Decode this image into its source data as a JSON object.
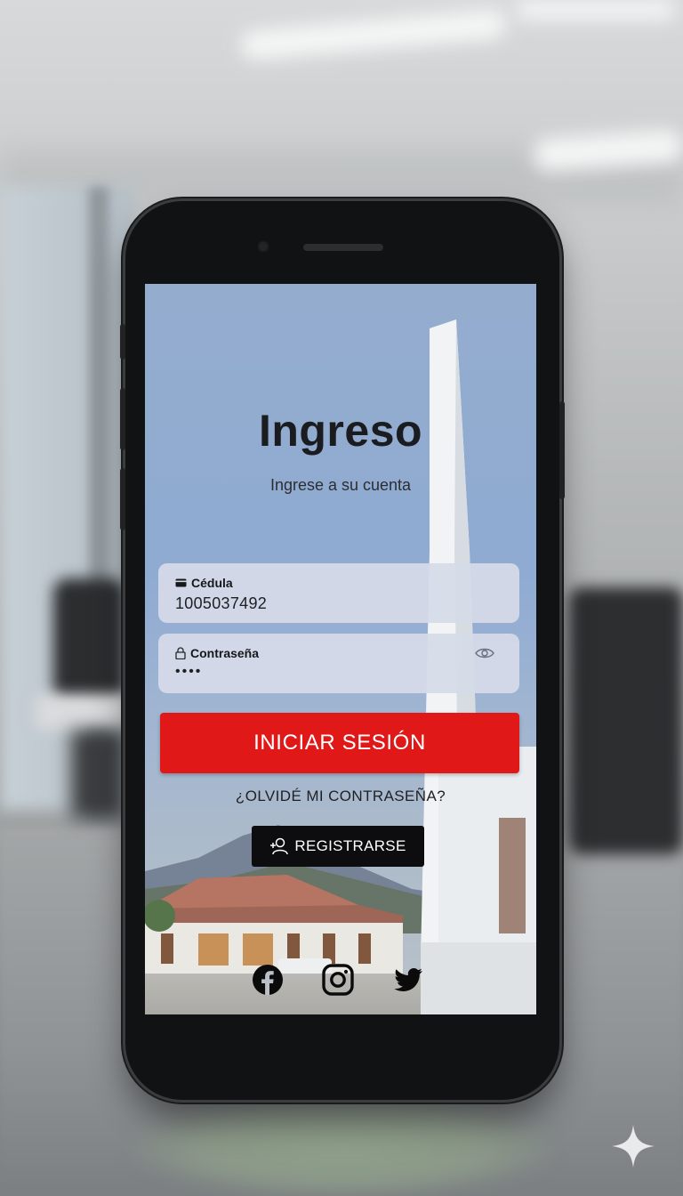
{
  "login": {
    "title": "Ingreso",
    "subtitle": "Ingrese a su cuenta",
    "id_field": {
      "label": "Cédula",
      "value": "1005037492",
      "icon": "id-card-icon"
    },
    "password_field": {
      "label": "Contraseña",
      "value": "••••",
      "icon": "lock-icon",
      "toggle_icon": "eye-icon"
    },
    "submit_label": "INICIAR SESIÓN",
    "forgot_label": "¿OLVIDÉ MI CONTRASEÑA?",
    "register_label": "REGISTRARSE",
    "register_icon": "add-user-icon"
  },
  "social": [
    {
      "name": "facebook",
      "icon": "facebook-icon"
    },
    {
      "name": "instagram",
      "icon": "instagram-icon"
    },
    {
      "name": "twitter",
      "icon": "twitter-icon"
    }
  ],
  "colors": {
    "accent": "#e01818",
    "register_bg": "#0d0d0f",
    "field_bg": "#d6dae8",
    "sky": "#8aa6d1"
  }
}
